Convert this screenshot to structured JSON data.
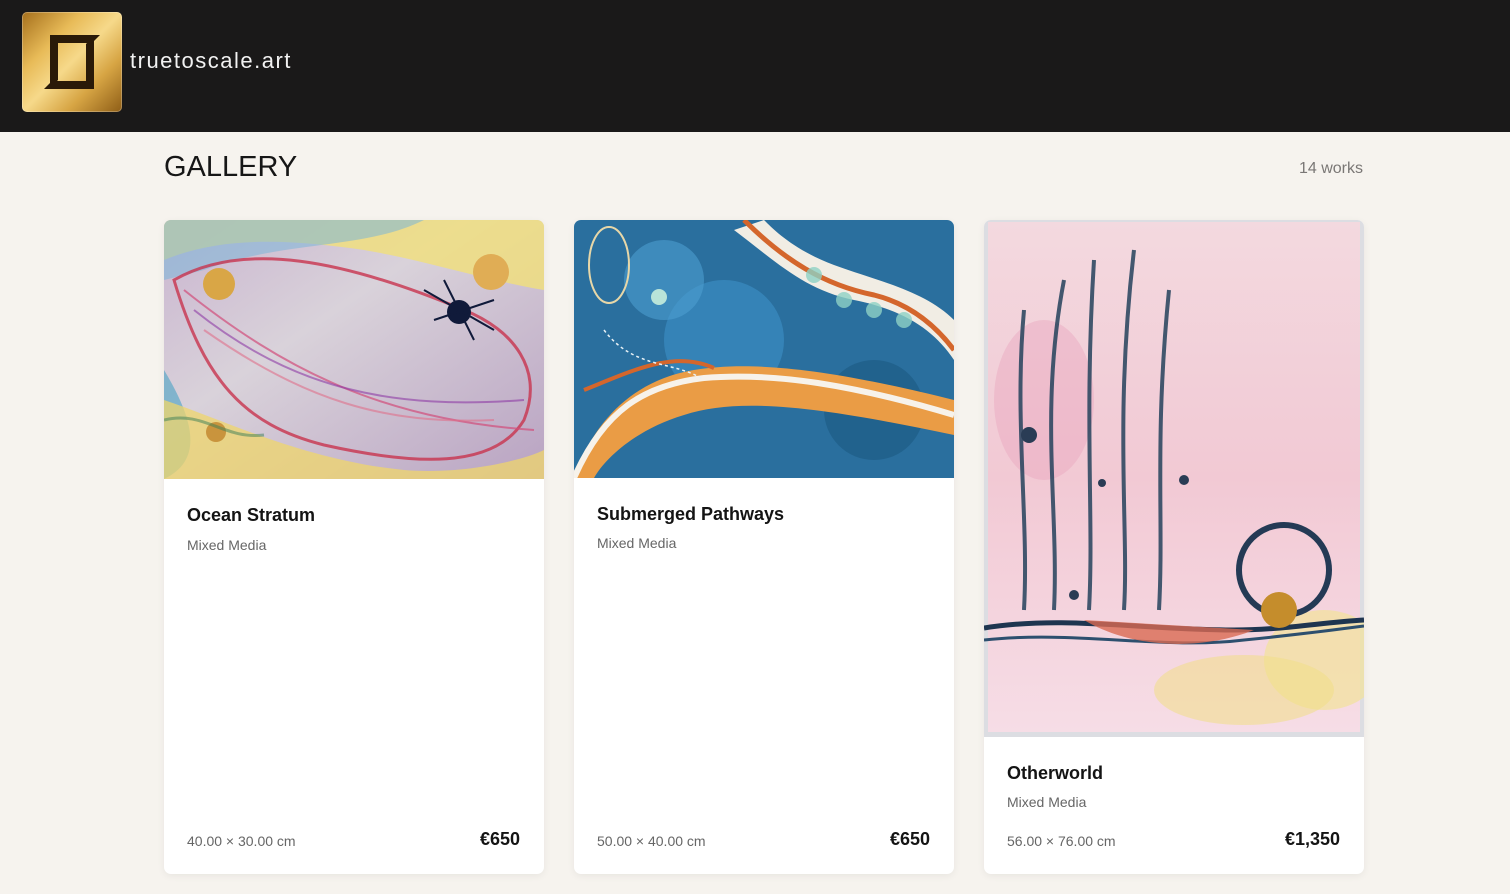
{
  "header": {
    "logo_icon": "gold-frame-logo-icon",
    "site_name": "truetoscale.art"
  },
  "gallery": {
    "title": "GALLERY",
    "count_label": "14 works",
    "artworks": [
      {
        "title": "Ocean Stratum",
        "medium": "Mixed Media",
        "dimensions": "40.00 × 30.00 cm",
        "price": "€650",
        "image": "watercolor-abstract-ocean-stratum"
      },
      {
        "title": "Submerged Pathways",
        "medium": "Mixed Media",
        "dimensions": "50.00 × 40.00 cm",
        "price": "€650",
        "image": "watercolor-abstract-submerged-pathways"
      },
      {
        "title": "Otherworld",
        "medium": "Mixed Media",
        "dimensions": "56.00 × 76.00 cm",
        "price": "€1,350",
        "image": "watercolor-abstract-otherworld"
      }
    ]
  }
}
